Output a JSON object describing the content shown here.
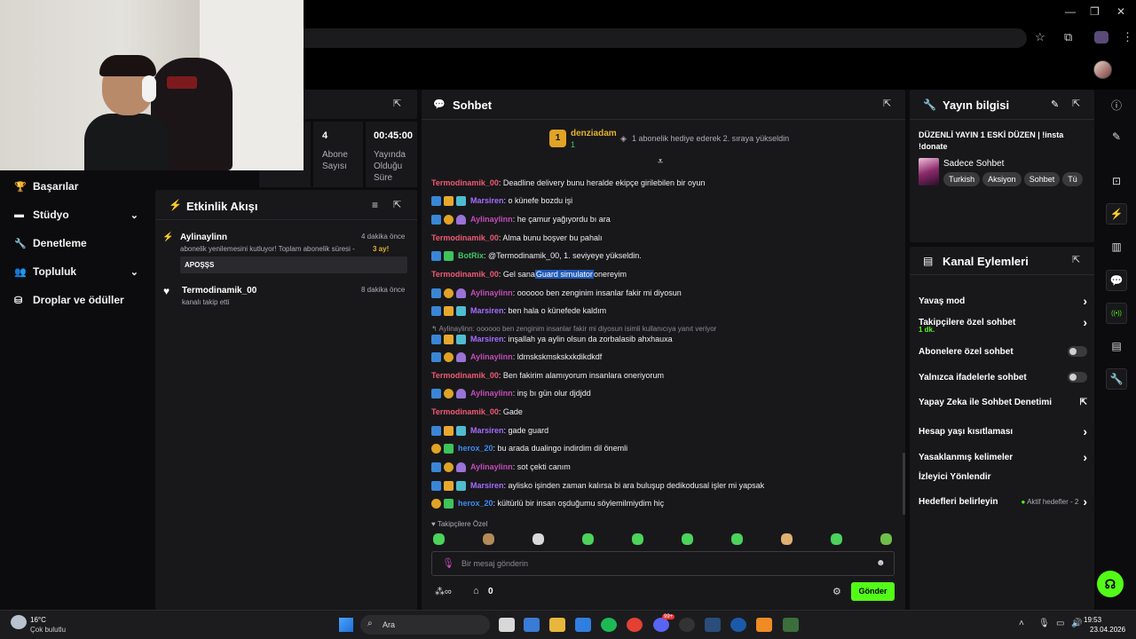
{
  "window": {
    "minimize": "—",
    "maximize": "❐",
    "close": "✕"
  },
  "toolbar_icons": {
    "star": "☆",
    "extensions": "⧉",
    "menu": "⋮"
  },
  "stats": [
    {
      "value": "4",
      "label": "Abone Sayısı"
    },
    {
      "value": "00:45:00",
      "label": "Yayında Olduğu Süre"
    }
  ],
  "sidebar": {
    "items": [
      {
        "icon": "trophy-icon",
        "glyph": "🏆",
        "label": "Başarılar",
        "chevron": ""
      },
      {
        "icon": "studio-icon",
        "glyph": "▬",
        "label": "Stüdyo",
        "chevron": "⌄"
      },
      {
        "icon": "wrench-icon",
        "glyph": "🔧",
        "label": "Denetleme",
        "chevron": ""
      },
      {
        "icon": "community-icon",
        "glyph": "👥",
        "label": "Topluluk",
        "chevron": "⌄"
      },
      {
        "icon": "drops-icon",
        "glyph": "⛁",
        "label": "Droplar ve ödüller",
        "chevron": ""
      }
    ]
  },
  "activity": {
    "title": "Etkinlik Akışı",
    "items": [
      {
        "name": "Aylinaylinn",
        "time": "4 dakika önce",
        "text": "abonelik yenilemesini kutluyor! Toplam abonelik süresi -",
        "months": "3 ay!",
        "message": "APOŞŞS"
      },
      {
        "name": "Termodinamik_00",
        "time": "8 dakika önce",
        "text": "kanalı takip etti"
      }
    ]
  },
  "chat": {
    "title": "Sohbet",
    "pinned": {
      "user": "denziadam",
      "count": "1",
      "text": "1 abonelik hediye ederek 2. sıraya yükseldin"
    },
    "messages": [
      {
        "badges": [],
        "user": "Termodinamik_00",
        "ucls": "u-term",
        "text": ": Deadline delivery bunu heralde ekipçe girilebilen bir oyun"
      },
      {
        "badges": [
          "b-blue",
          "b-crown",
          "b-cyan"
        ],
        "user": "Marsiren",
        "ucls": "u-mars",
        "text": ": o künefe bozdu işi"
      },
      {
        "badges": [
          "b-blue",
          "b-gold",
          "b-purple"
        ],
        "user": "Aylinaylinn",
        "ucls": "u-ayl",
        "text": ": he çamur yağıyordu bı ara"
      },
      {
        "badges": [],
        "user": "Termodinamik_00",
        "ucls": "u-term",
        "text": ": Alma bunu boşver bu pahalı"
      },
      {
        "badges": [
          "b-blue",
          "b-green"
        ],
        "user": "BotRix",
        "ucls": "u-bot",
        "text": ": @Termodinamik_00, 1. seviyeye yükseldin."
      },
      {
        "badges": [],
        "user": "Termodinamik_00",
        "ucls": "u-term",
        "text": ": Gel sana ",
        "hl": "Guard simulator",
        "after": " onereyim"
      },
      {
        "badges": [
          "b-blue",
          "b-gold",
          "b-purple"
        ],
        "user": "Aylinaylinn",
        "ucls": "u-ayl",
        "text": ": oooooo ben zenginim insanlar fakir mi diyosun"
      },
      {
        "badges": [
          "b-blue",
          "b-crown",
          "b-cyan"
        ],
        "user": "Marsiren",
        "ucls": "u-mars",
        "text": ": ben hala o künefede kaldım"
      },
      {
        "reply": "↰ Aylinaylinn: oooooo ben zenginim insanlar fakir mi diyosun isimli kullanıcıya yanıt veriyor"
      },
      {
        "badges": [
          "b-blue",
          "b-crown",
          "b-cyan"
        ],
        "user": "Marsiren",
        "ucls": "u-mars",
        "text": ": inşallah ya aylin olsun da zorbalasib ahxhauxa"
      },
      {
        "badges": [
          "b-blue",
          "b-gold",
          "b-purple"
        ],
        "user": "Aylinaylinn",
        "ucls": "u-ayl",
        "text": ": ldmskskmskskxkdikdkdf"
      },
      {
        "badges": [],
        "user": "Termodinamik_00",
        "ucls": "u-term",
        "text": ": Ben fakirim alamıyorum insanlara oneriyorum"
      },
      {
        "badges": [
          "b-blue",
          "b-gold",
          "b-purple"
        ],
        "user": "Aylinaylinn",
        "ucls": "u-ayl",
        "text": ": inş bı gün olur djdjdd"
      },
      {
        "badges": [],
        "user": "Termodinamik_00",
        "ucls": "u-term",
        "text": ": Gade"
      },
      {
        "badges": [
          "b-blue",
          "b-crown",
          "b-cyan"
        ],
        "user": "Marsiren",
        "ucls": "u-mars",
        "text": ": gade guard"
      },
      {
        "badges": [
          "b-gold",
          "b-green"
        ],
        "user": "herox_20",
        "ucls": "u-hero",
        "text": ": bu arada dualingo indirdim dil önemli"
      },
      {
        "badges": [
          "b-blue",
          "b-gold",
          "b-purple"
        ],
        "user": "Aylinaylinn",
        "ucls": "u-ayl",
        "text": ": sot çekti canım"
      },
      {
        "badges": [
          "b-blue",
          "b-crown",
          "b-cyan"
        ],
        "user": "Marsiren",
        "ucls": "u-mars",
        "text": ": aylisko işinden zaman kalırsa bi ara buluşup dedikodusal işler mi yapsak"
      },
      {
        "badges": [
          "b-gold",
          "b-green"
        ],
        "user": "herox_20",
        "ucls": "u-hero",
        "text": ": kültürlü bir insan oşduğumu söylemilmiydim hiç"
      }
    ],
    "followers_label": "Takipçilere Özel",
    "input_placeholder": "Bir mesaj gönderin",
    "points": "0",
    "send": "Gönder"
  },
  "stream_info": {
    "title": "Yayın bilgisi",
    "stream_title": "DÜZENLİ YAYIN 1 ESKİ DÜZEN | !insta !donate",
    "category": "Sadece Sohbet",
    "tags": [
      "Turkish",
      "Aksiyon",
      "Sohbet",
      "Tü"
    ]
  },
  "channel_actions": {
    "title": "Kanal Eylemleri",
    "rows": [
      {
        "label": "Yavaş mod",
        "type": "chev"
      },
      {
        "label": "Takipçilere özel sohbet",
        "sub": "1 dk.",
        "type": "chev"
      },
      {
        "label": "Abonelere özel sohbet",
        "type": "toggle"
      },
      {
        "label": "Yalnızca ifadelerle sohbet",
        "type": "toggle"
      },
      {
        "label": "Yapay Zeka ile Sohbet Denetimi",
        "type": "ext"
      },
      {
        "label": "Hesap yaşı kısıtlaması",
        "type": "chev"
      },
      {
        "label": "Yasaklanmış kelimeler",
        "type": "chev"
      },
      {
        "label": "İzleyici Yönlendir",
        "type": "none"
      },
      {
        "label": "Hedefleri belirleyin",
        "type": "chev",
        "extra": "Aktif hedefler - 2"
      }
    ]
  },
  "taskbar": {
    "temp": "16°C",
    "weather": "Çok bulutlu",
    "search": "Ara",
    "time": "19:53",
    "date": "23.04.2026",
    "badge": "99+"
  }
}
